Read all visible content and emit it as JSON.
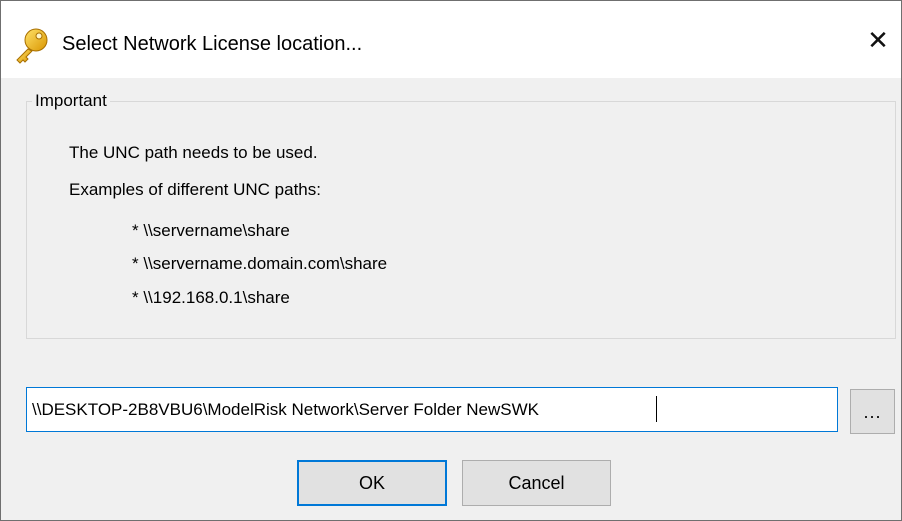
{
  "window": {
    "title": "Select Network License location...",
    "close_label": "✕",
    "icon": "key-icon"
  },
  "group": {
    "legend": "Important",
    "line1": "The UNC path needs to be used.",
    "line2": "Examples of different UNC paths:",
    "examples": [
      "* \\\\servername\\share",
      "* \\\\servername.domain.com\\share",
      "* \\\\192.168.0.1\\share"
    ]
  },
  "path_field": {
    "value": "\\\\DESKTOP-2B8VBU6\\ModelRisk Network\\Server Folder NewSWK"
  },
  "buttons": {
    "browse": "...",
    "ok": "OK",
    "cancel": "Cancel"
  },
  "colors": {
    "focus": "#0078d7",
    "key_gold": "#f2b600"
  }
}
